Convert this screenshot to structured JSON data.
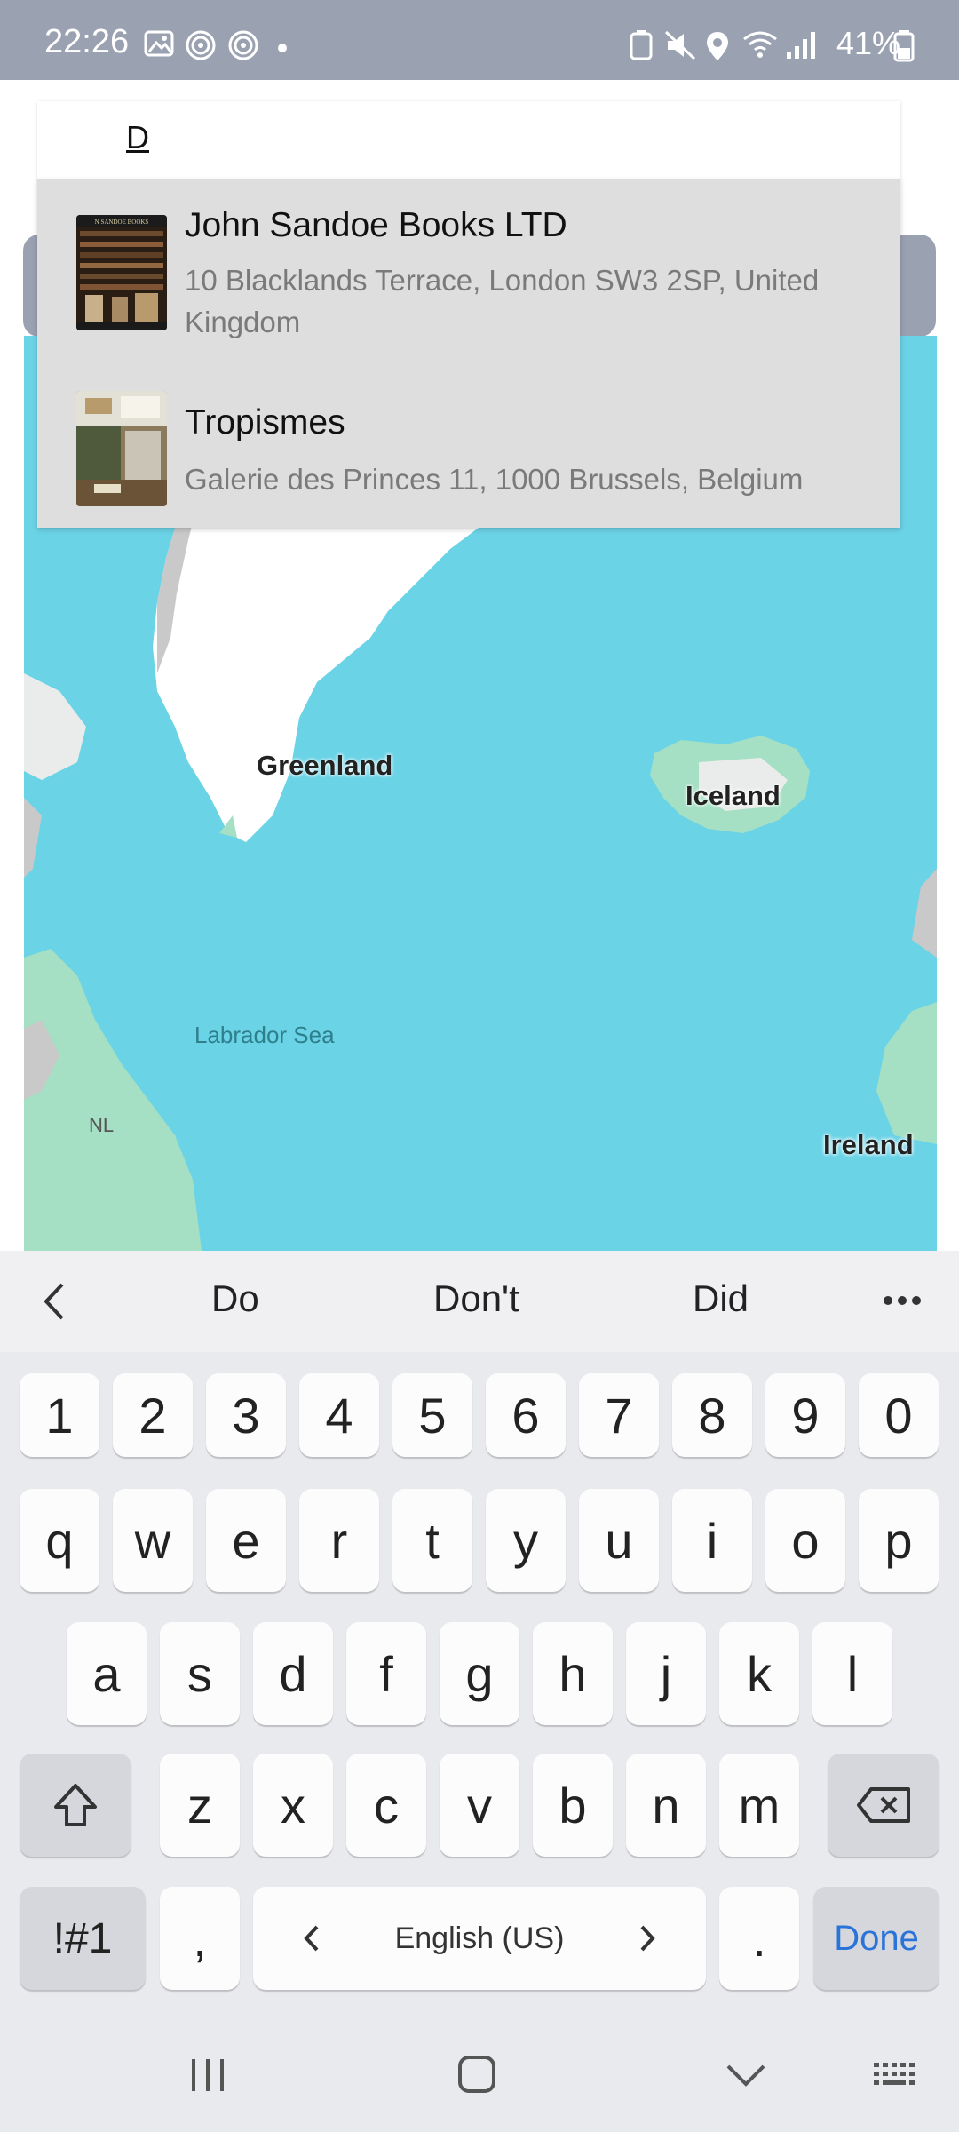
{
  "status_bar": {
    "time": "22:26",
    "battery": "41%"
  },
  "search": {
    "query": "D"
  },
  "suggestions": [
    {
      "name": "John Sandoe Books LTD",
      "address": "10 Blacklands Terrace, London SW3 2SP, United Kingdom",
      "thumb_sign": "N SANDOE BOOKS"
    },
    {
      "name": "Tropismes",
      "address": "Galerie des Princes 11, 1000 Brussels, Belgium"
    }
  ],
  "map": {
    "labels": {
      "greenland": "Greenland",
      "iceland": "Iceland",
      "labrador_sea": "Labrador Sea",
      "nl": "NL",
      "ireland": "Ireland"
    },
    "colors": {
      "water": "#6bd3e6",
      "land": "#ffffff",
      "vegetation": "#a5e0c4"
    }
  },
  "keyboard": {
    "word_suggestions": [
      "Do",
      "Don't",
      "Did"
    ],
    "number_row": [
      "1",
      "2",
      "3",
      "4",
      "5",
      "6",
      "7",
      "8",
      "9",
      "0"
    ],
    "row1": [
      "q",
      "w",
      "e",
      "r",
      "t",
      "y",
      "u",
      "i",
      "o",
      "p"
    ],
    "row2": [
      "a",
      "s",
      "d",
      "f",
      "g",
      "h",
      "j",
      "k",
      "l"
    ],
    "row3": [
      "z",
      "x",
      "c",
      "v",
      "b",
      "n",
      "m"
    ],
    "symbols_label": "!#1",
    "comma": ",",
    "space_label": "English (US)",
    "period": ".",
    "done_label": "Done",
    "accent_color": "#2a74d9"
  }
}
